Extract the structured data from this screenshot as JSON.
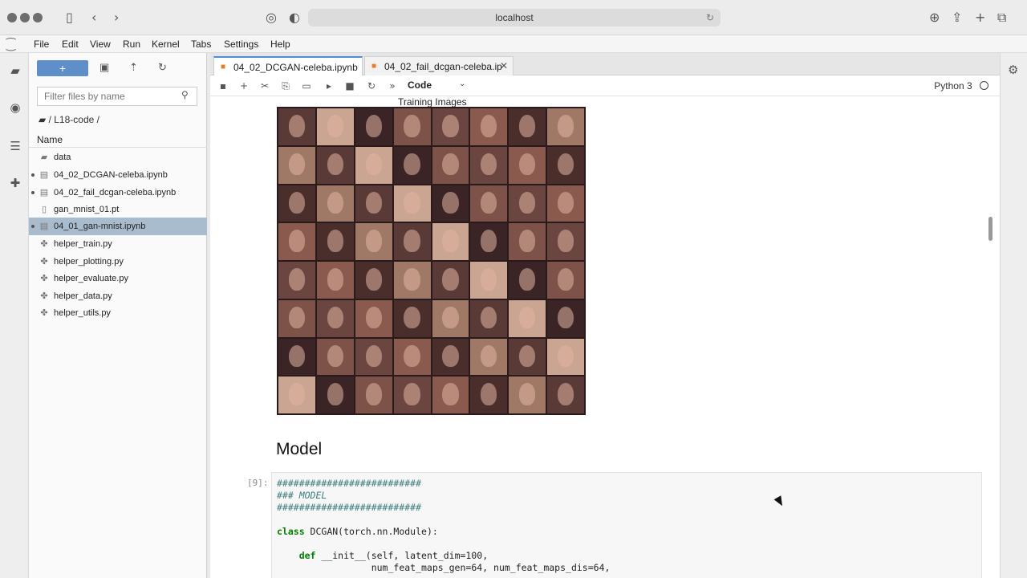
{
  "browser": {
    "url": "localhost",
    "buttons": [
      "sidebar-toggle",
      "back",
      "forward"
    ]
  },
  "menubar": {
    "items": [
      "File",
      "Edit",
      "View",
      "Run",
      "Kernel",
      "Tabs",
      "Settings",
      "Help"
    ]
  },
  "filebrowser": {
    "new_label": "+",
    "filter_placeholder": "Filter files by name",
    "breadcrumb": "/ L18-code /",
    "column_header": "Name",
    "files": [
      {
        "name": "data",
        "type": "folder",
        "running": false,
        "selected": false
      },
      {
        "name": "04_02_DCGAN-celeba.ipynb",
        "type": "notebook",
        "running": true,
        "selected": false
      },
      {
        "name": "04_02_fail_dcgan-celeba.ipynb",
        "type": "notebook",
        "running": true,
        "selected": false
      },
      {
        "name": "gan_mnist_01.pt",
        "type": "file",
        "running": false,
        "selected": false
      },
      {
        "name": "04_01_gan-mnist.ipynb",
        "type": "notebook",
        "running": true,
        "selected": true
      },
      {
        "name": "helper_train.py",
        "type": "python",
        "running": false,
        "selected": false
      },
      {
        "name": "helper_plotting.py",
        "type": "python",
        "running": false,
        "selected": false
      },
      {
        "name": "helper_evaluate.py",
        "type": "python",
        "running": false,
        "selected": false
      },
      {
        "name": "helper_data.py",
        "type": "python",
        "running": false,
        "selected": false
      },
      {
        "name": "helper_utils.py",
        "type": "python",
        "running": false,
        "selected": false
      }
    ]
  },
  "tabs": [
    {
      "label": "04_02_DCGAN-celeba.ipynb",
      "active": true
    },
    {
      "label": "04_02_fail_dcgan-celeba.ip",
      "active": false
    }
  ],
  "toolbar": {
    "cell_type": "Code",
    "kernel_name": "Python 3"
  },
  "notebook": {
    "plot_title": "Training Images",
    "heading": "Model",
    "prompt": "[9]:",
    "code_lines": [
      {
        "text": "##########################",
        "kind": "comment"
      },
      {
        "text": "### MODEL",
        "kind": "comment"
      },
      {
        "text": "##########################",
        "kind": "comment"
      },
      {
        "text": "",
        "kind": "plain"
      },
      {
        "text": "class DCGAN(torch.nn.Module):",
        "kind": "class"
      },
      {
        "text": "",
        "kind": "plain"
      },
      {
        "text": "    def __init__(self, latent_dim=100,",
        "kind": "def"
      },
      {
        "text": "                 num_feat_maps_gen=64, num_feat_maps_dis=64,",
        "kind": "plain"
      }
    ]
  },
  "colors": {
    "accent": "#5e8fc9",
    "selected_row": "#a9bccd",
    "notebook_icon": "#f07b22"
  }
}
